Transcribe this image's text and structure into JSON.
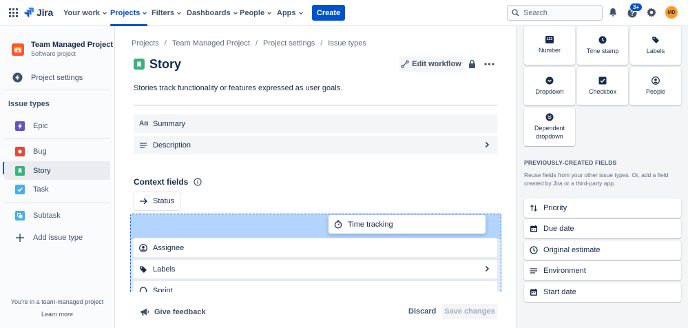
{
  "nav": {
    "logo_text": "Jira",
    "items": [
      "Your work",
      "Projects",
      "Filters",
      "Dashboards",
      "People",
      "Apps"
    ],
    "create_label": "Create",
    "search_placeholder": "Search",
    "notifications_badge": "3+",
    "avatar_initials": "MD"
  },
  "sidebar": {
    "project_name": "Team Managed Project",
    "project_type": "Software project",
    "back_label": "Project settings",
    "section_title": "Issue types",
    "issue_types": [
      "Epic",
      "Bug",
      "Story",
      "Task",
      "Subtask"
    ],
    "add_label": "Add issue type",
    "footer_line1": "You're in a team-managed project",
    "footer_link": "Learn more"
  },
  "breadcrumb": [
    "Projects",
    "Team Managed Project",
    "Project settings",
    "Issue types"
  ],
  "main": {
    "title": "Story",
    "edit_workflow": "Edit workflow",
    "description": "Stories track functionality or features expressed as user goals.",
    "description_fields": [
      "Summary",
      "Description"
    ],
    "context_title": "Context fields",
    "status_label": "Status",
    "dragging_field": "Time tracking",
    "context_fields": [
      "Assignee",
      "Labels",
      "Sprint"
    ],
    "feedback": "Give feedback",
    "discard": "Discard",
    "save": "Save changes"
  },
  "rpanel": {
    "tiles": [
      "Number",
      "Time stamp",
      "Labels",
      "Dropdown",
      "Checkbox",
      "People",
      "Dependent dropdown"
    ],
    "number_icon_text": "123",
    "prev_title": "PREVIOUSLY-CREATED FIELDS",
    "prev_desc": "Reuse fields from your other issue types. Or, add a field created by Jira or a third-party app.",
    "prev_fields": [
      "Priority",
      "Due date",
      "Original estimate",
      "Environment",
      "Start date"
    ]
  },
  "colors": {
    "brand": "#0052cc",
    "epic": "#6554c0",
    "bug": "#e5493a",
    "story": "#36b37e",
    "task": "#4bade8",
    "subtask": "#4bade8"
  }
}
